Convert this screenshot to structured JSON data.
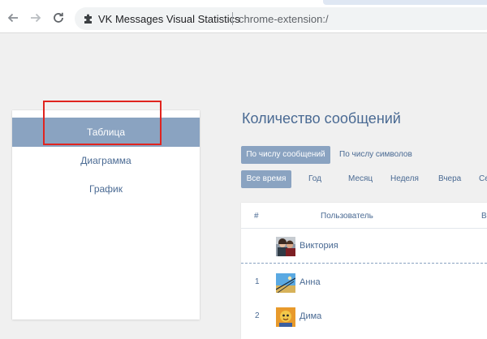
{
  "browser": {
    "page_name": "VK Messages Visual Statistics",
    "url": "chrome-extension:/",
    "icons": {
      "back": "arrow-left-icon",
      "forward": "arrow-right-icon",
      "reload": "reload-icon",
      "extension": "puzzle-piece-icon"
    }
  },
  "sidebar": {
    "items": [
      {
        "label": "Таблица",
        "active": true
      },
      {
        "label": "Диаграмма",
        "active": false
      },
      {
        "label": "График",
        "active": false
      }
    ],
    "highlight_color": "#e0241f"
  },
  "main": {
    "title": "Количество сообщений",
    "count_modes": [
      {
        "label": "По числу сообщений",
        "active": true
      },
      {
        "label": "По числу символов",
        "active": false
      }
    ],
    "periods": [
      {
        "label": "Все время",
        "active": true
      },
      {
        "label": "Год",
        "active": false
      },
      {
        "label": "Месяц",
        "active": false
      },
      {
        "label": "Неделя",
        "active": false
      },
      {
        "label": "Вчера",
        "active": false
      },
      {
        "label": "Се",
        "active": false
      }
    ]
  },
  "table": {
    "columns": [
      "#",
      "Пользователь",
      "Во"
    ],
    "rows": [
      {
        "rank": "",
        "name": "Виктория",
        "avatar": "couple-photo-avatar"
      },
      {
        "rank": "1",
        "name": "Анна",
        "avatar": "blue-sky-photo-avatar"
      },
      {
        "rank": "2",
        "name": "Дима",
        "avatar": "cartoon-character-avatar"
      }
    ]
  },
  "colors": {
    "accent": "#8aa3c1",
    "link": "#4a6a93",
    "background": "#f0f0f0"
  }
}
